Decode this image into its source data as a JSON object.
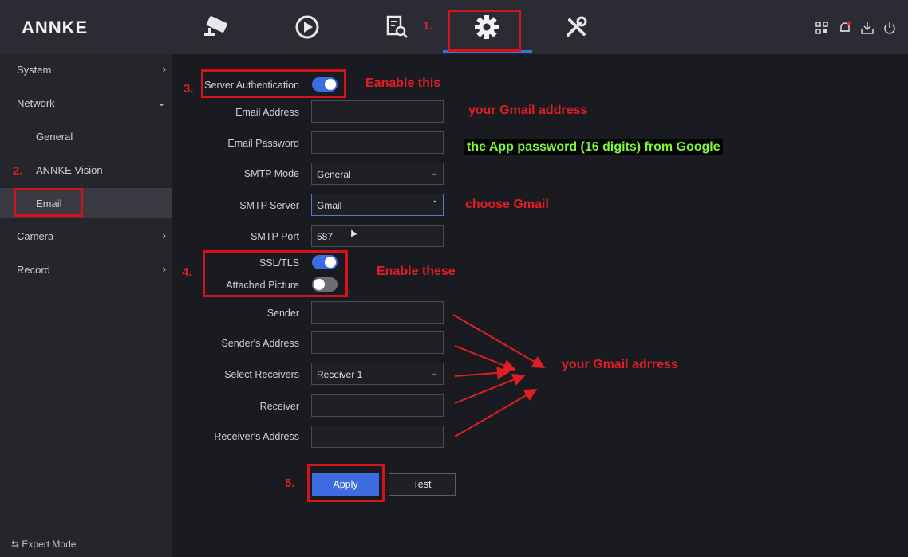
{
  "app": {
    "logo": "ANNKE"
  },
  "top_nav": {
    "icons": [
      "live-view-camera-icon",
      "playback-icon",
      "file-search-icon",
      "settings-gear-icon",
      "maintenance-tools-icon"
    ],
    "active": "settings-gear-icon",
    "right_icons": [
      "qr-code-icon",
      "bell-icon",
      "download-icon",
      "power-icon"
    ]
  },
  "sidebar": {
    "items": [
      {
        "label": "System",
        "chevron": "›"
      },
      {
        "label": "Network",
        "chevron": "⌄"
      },
      {
        "label": "General",
        "chevron": ""
      },
      {
        "label": "ANNKE Vision",
        "chevron": ""
      },
      {
        "label": "Email",
        "chevron": ""
      },
      {
        "label": "Camera",
        "chevron": "›"
      },
      {
        "label": "Record",
        "chevron": "›"
      }
    ],
    "selected": "Email",
    "footer_icon": "⇆",
    "footer": "Expert Mode"
  },
  "form": {
    "server_auth": {
      "label": "Server Authentication",
      "on": true
    },
    "email_address": {
      "label": "Email Address",
      "value": ""
    },
    "email_password": {
      "label": "Email Password",
      "value": ""
    },
    "smtp_mode": {
      "label": "SMTP Mode",
      "value": "General"
    },
    "smtp_server": {
      "label": "SMTP Server",
      "value": "Gmail"
    },
    "smtp_port": {
      "label": "SMTP Port",
      "value": "587"
    },
    "ssl_tls": {
      "label": "SSL/TLS",
      "on": true
    },
    "attached_picture": {
      "label": "Attached Picture",
      "on": false
    },
    "sender": {
      "label": "Sender",
      "value": ""
    },
    "senders_address": {
      "label": "Sender's Address",
      "value": ""
    },
    "select_receivers": {
      "label": "Select Receivers",
      "value": "Receiver 1"
    },
    "receiver": {
      "label": "Receiver",
      "value": ""
    },
    "receivers_address": {
      "label": "Receiver's Address",
      "value": ""
    }
  },
  "buttons": {
    "apply": "Apply",
    "test": "Test"
  },
  "annotations": {
    "step1": "1.",
    "step2": "2.",
    "step3": "3.",
    "step4": "4.",
    "step5": "5.",
    "enable_this": "Eanable this",
    "gmail_address": "your Gmail address",
    "app_password": "the App password (16 digits) from Google",
    "choose_gmail": "choose Gmail",
    "enable_these": "Enable these",
    "gmail_adrress": "your Gmail adrress"
  },
  "colors": {
    "accent": "#3d6be0",
    "annotation_red": "#e01e25",
    "annotation_green": "#7ef43a"
  }
}
